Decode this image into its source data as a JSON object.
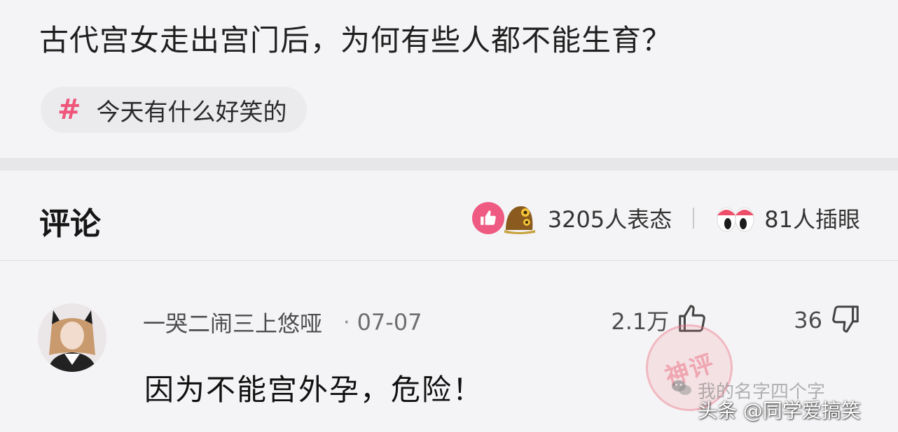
{
  "post": {
    "title": "古代宫女走出宫门后，为何有些人都不能生育？",
    "topic_symbol": "#",
    "topic": "今天有什么好笑的"
  },
  "comments_section": {
    "title": "评论",
    "reaction_count": "3205人表态",
    "eyes_count": "81人插眼"
  },
  "comment": {
    "username": "一哭二闹三上悠哑",
    "dot": "·",
    "date": "07-07",
    "likes": "2.1万",
    "dislikes": "36",
    "text": "因为不能宫外孕，危险！"
  },
  "watermark": {
    "stamp": "神评",
    "wechat_text": "我的名字四个字",
    "source": "头条 @同学爱搞笑"
  },
  "colors": {
    "accent_pink": "#ee5a82",
    "hash_pink": "#f0557a",
    "background": "#f4f4f6"
  },
  "icons": [
    "hash-icon",
    "thumbs-up-reaction-icon",
    "owl-reaction-icon",
    "eyes-reaction-icon",
    "thumbs-up-icon",
    "thumbs-down-icon",
    "wechat-icon"
  ]
}
